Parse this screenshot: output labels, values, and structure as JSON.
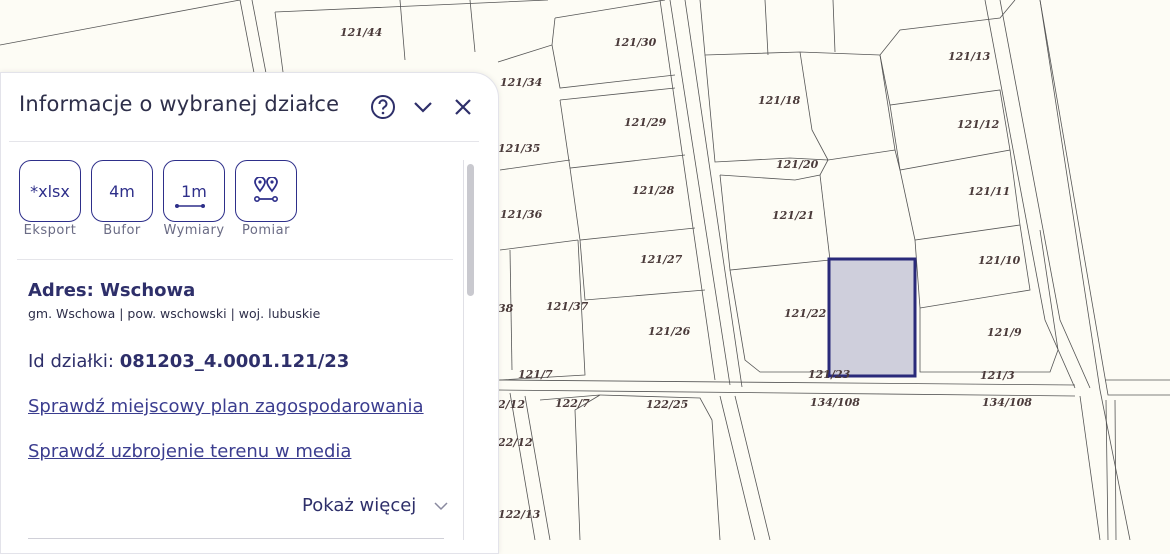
{
  "panel": {
    "title": "Informacje o wybranej działce",
    "tools": [
      {
        "glyph": "*xlsx",
        "caption": "Eksport"
      },
      {
        "glyph": "4m",
        "caption": "Bufor"
      },
      {
        "glyph": "1m",
        "caption": "Wymiary"
      },
      {
        "glyph": "",
        "caption": "Pomiar"
      }
    ],
    "address_label": "Adres: Wschowa",
    "admin_line": "gm. Wschowa | pow. wschowski | woj. lubuskie",
    "id_label": "Id działki: ",
    "id_value": "081203_4.0001.121/23",
    "link_plan": "Sprawdź miejscowy plan zagospodarowania",
    "link_media": "Sprawdź uzbrojenie terenu w media",
    "show_more": "Pokaż więcej"
  },
  "map": {
    "labels": [
      "121/44",
      "121/30",
      "121/13",
      "121/34",
      "121/18",
      "121/35",
      "121/29",
      "121/12",
      "121/20",
      "121/36",
      "121/28",
      "121/21",
      "121/11",
      "121/27",
      "121/10",
      "38",
      "121/37",
      "121/26",
      "121/22",
      "121/9",
      "121/7",
      "121/23",
      "121/3",
      "2/12",
      "122/7",
      "122/25",
      "134/108",
      "134/108",
      "22/12",
      "122/13"
    ],
    "selected_color": "#2a2a7a",
    "selected_fill": "#cfcfdc"
  }
}
